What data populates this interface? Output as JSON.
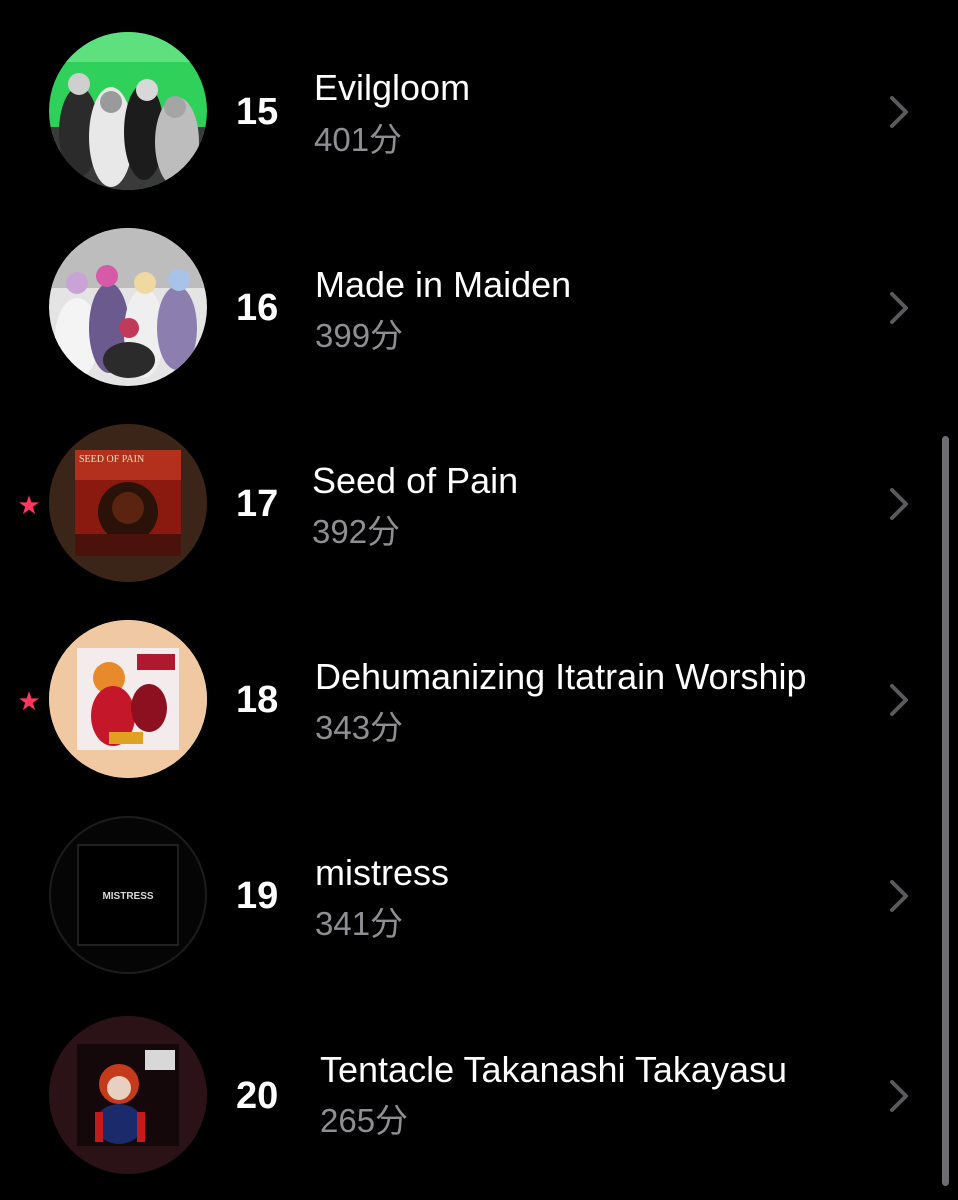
{
  "accent_color": "#ff375f",
  "secondary_text_color": "#8e8e93",
  "rows": [
    {
      "rank": "15",
      "title": "Evilgloom",
      "minutes": "401分",
      "starred": false,
      "artwork": "band-photo-green-background",
      "artwork_text": ""
    },
    {
      "rank": "16",
      "title": "Made in Maiden",
      "minutes": "399分",
      "starred": false,
      "artwork": "band-photo-white-costumes",
      "artwork_text": ""
    },
    {
      "rank": "17",
      "title": "Seed of Pain",
      "minutes": "392分",
      "starred": true,
      "star": "★",
      "artwork": "album-cover-red-demon",
      "artwork_text": "SEED OF PAIN"
    },
    {
      "rank": "18",
      "title": "Dehumanizing Itatrain Worship",
      "minutes": "343分",
      "starred": true,
      "star": "★",
      "artwork": "album-cover-anime-girl",
      "artwork_text": ""
    },
    {
      "rank": "19",
      "title": "mistress",
      "minutes": "341分",
      "starred": false,
      "artwork": "album-cover-black-logo",
      "artwork_text": "MISTRESS"
    },
    {
      "rank": "20",
      "title": "Tentacle Takanashi Takayasu",
      "minutes": "265分",
      "starred": false,
      "artwork": "album-cover-dark-character",
      "artwork_text": ""
    }
  ],
  "icons": {
    "chevron": "chevron-right-icon",
    "star": "star-icon"
  }
}
